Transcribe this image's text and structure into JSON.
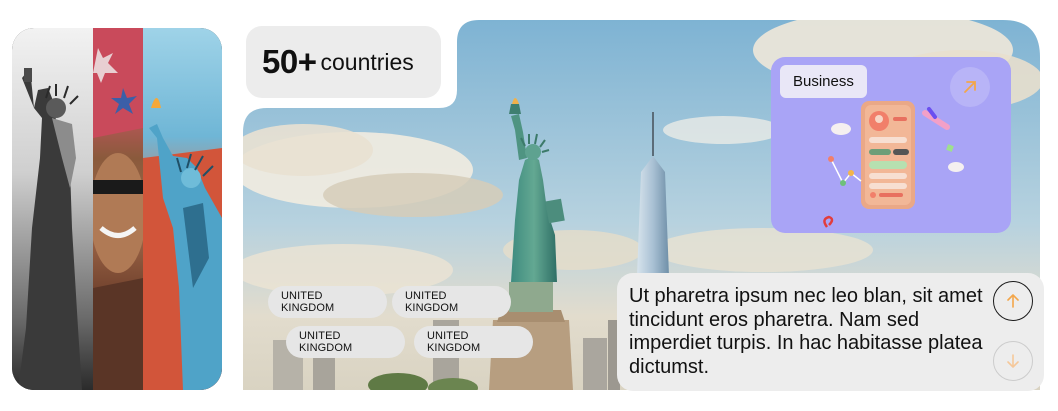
{
  "stats": {
    "number": "50+",
    "label": "countries"
  },
  "business_card": {
    "badge": "Business",
    "arrow_icon": "arrow-up-right-icon"
  },
  "chips": [
    {
      "label": "UNITED KINGDOM"
    },
    {
      "label": "UNITED KINGDOM"
    },
    {
      "label": "UNITED KINGDOM"
    },
    {
      "label": "UNITED KINGDOM"
    }
  ],
  "description": "Ut pharetra ipsum nec leo blan, sit amet tincidunt eros pharetra. Nam sed imperdiet turpis. In hac habitasse platea dictumst.",
  "nav": {
    "up_icon": "arrow-up-icon",
    "down_icon": "arrow-down-icon"
  },
  "colors": {
    "card_purple": "#a9a4f6",
    "chip_bg": "#e6e6e6",
    "panel_bg": "#ededed",
    "arrow_accent": "#f3a64a"
  }
}
